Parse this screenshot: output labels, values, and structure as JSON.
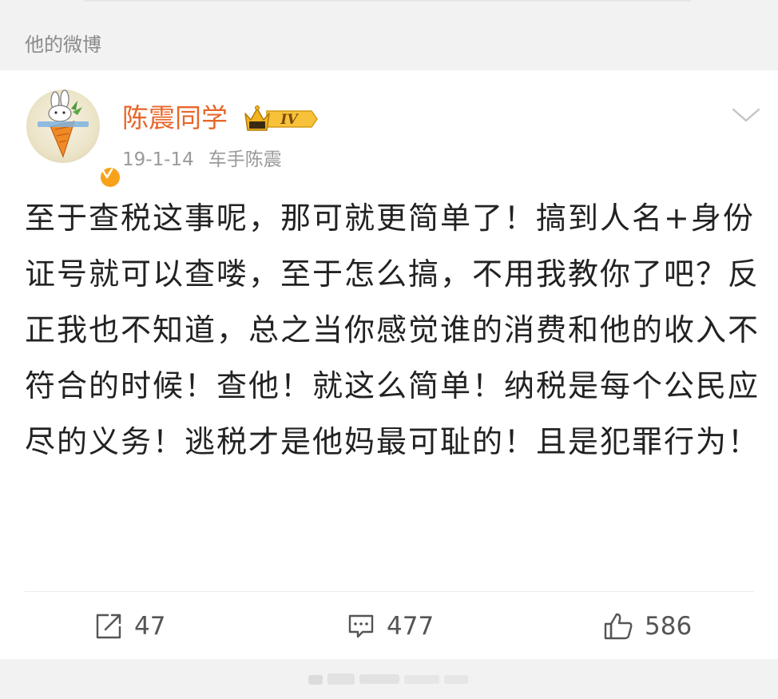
{
  "section": {
    "title": "他的微博"
  },
  "post": {
    "author": {
      "name": "陈震同学",
      "level_badge": "IV",
      "avatar_icon": "carrot-avatar-icon",
      "verified_icon": "verified-v-icon"
    },
    "date": "19-1-14",
    "source": "车手陈震",
    "text": "至于查税这事呢，那可就更简单了！搞到人名+身份证号就可以查喽，至于怎么搞，不用我教你了吧？反正我也不知道，总之当你感觉谁的消费和他的收入不符合的时候！查他！就这么简单！纳税是每个公民应尽的义务！逃税才是他妈最可耻的！且是犯罪行为！",
    "actions": {
      "repost": {
        "icon": "repost-icon",
        "count": "47"
      },
      "comment": {
        "icon": "comment-icon",
        "count": "477"
      },
      "like": {
        "icon": "thumbs-up-icon",
        "count": "586"
      }
    }
  },
  "colors": {
    "username": "#e8662a",
    "badge_gold": "#f2b51f",
    "verified": "#f7a21a",
    "page_bg": "#f2f2f2"
  }
}
